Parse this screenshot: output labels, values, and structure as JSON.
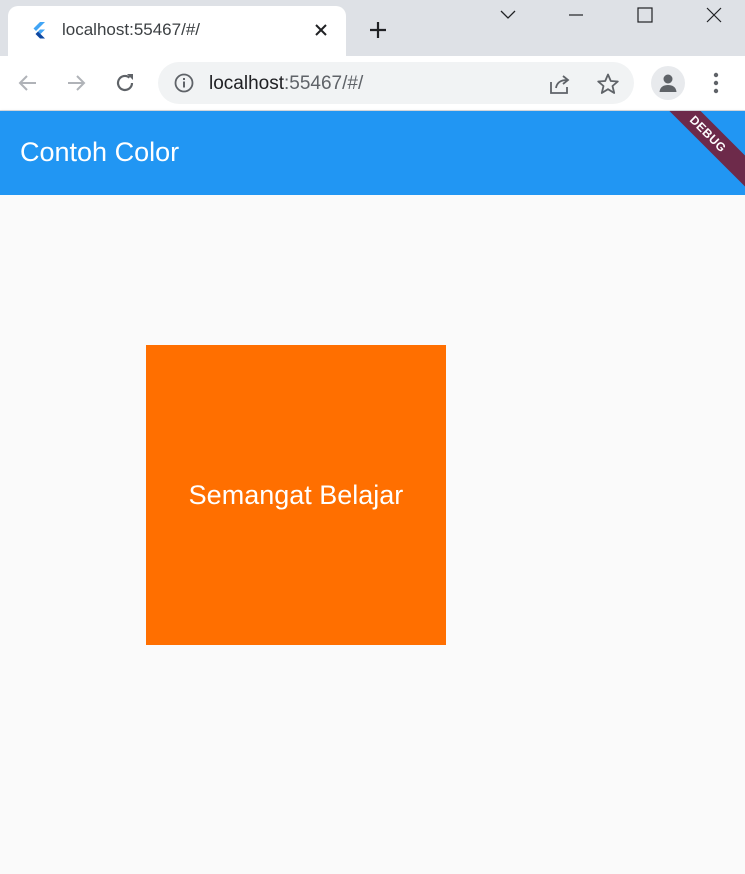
{
  "browser": {
    "tab": {
      "title": "localhost:55467/#/",
      "favicon": "flutter-logo-icon"
    },
    "address": {
      "host": "localhost",
      "rest": ":55467/#/"
    },
    "icons": {
      "back": "arrow-left-icon",
      "forward": "arrow-right-icon",
      "reload": "reload-icon",
      "info": "info-icon",
      "share": "share-icon",
      "star": "star-icon",
      "profile": "profile-icon",
      "menu": "kebab-menu-icon"
    }
  },
  "app": {
    "title": "Contoh Color",
    "debug_banner": "DEBUG",
    "box": {
      "label": "Semangat Belajar",
      "color": "#ff6f00"
    },
    "colors": {
      "appbar": "#2196f3",
      "background": "#fafafa"
    }
  }
}
